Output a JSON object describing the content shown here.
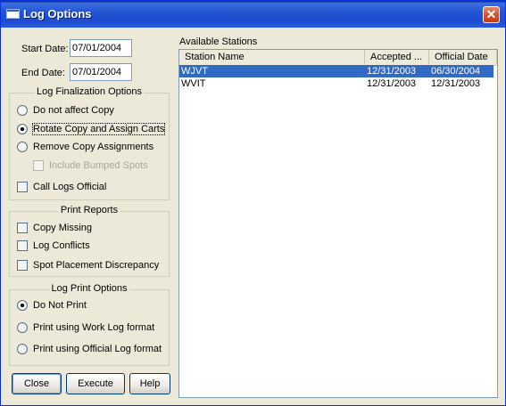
{
  "window": {
    "title": "Log Options"
  },
  "dates": {
    "start_label": "Start Date:",
    "start_value": "07/01/2004",
    "end_label": "End Date:",
    "end_value": "07/01/2004"
  },
  "finalization": {
    "title": "Log Finalization Options",
    "options": [
      "Do not affect Copy",
      "Rotate Copy and Assign Carts",
      "Remove Copy Assignments"
    ],
    "selected": "Rotate Copy and Assign Carts",
    "include_bumped": "Include Bumped Spots",
    "call_logs_official": "Call Logs Official"
  },
  "print_reports": {
    "title": "Print Reports",
    "items": [
      "Copy Missing",
      "Log Conflicts",
      "Spot Placement Discrepancy"
    ]
  },
  "log_print": {
    "title": "Log Print Options",
    "options": [
      "Do Not Print",
      "Print using Work Log format",
      "Print using Official Log format"
    ],
    "selected": "Do Not Print"
  },
  "buttons": {
    "close": "Close",
    "execute": "Execute",
    "help": "Help"
  },
  "stations": {
    "label": "Available Stations",
    "columns": [
      "Station Name",
      "Accepted ...",
      "Official Date"
    ],
    "rows": [
      {
        "name": "WJVT",
        "accepted": "12/31/2003",
        "official": "06/30/2004",
        "selected": true
      },
      {
        "name": "WVIT",
        "accepted": "12/31/2003",
        "official": "12/31/2003",
        "selected": false
      }
    ]
  }
}
